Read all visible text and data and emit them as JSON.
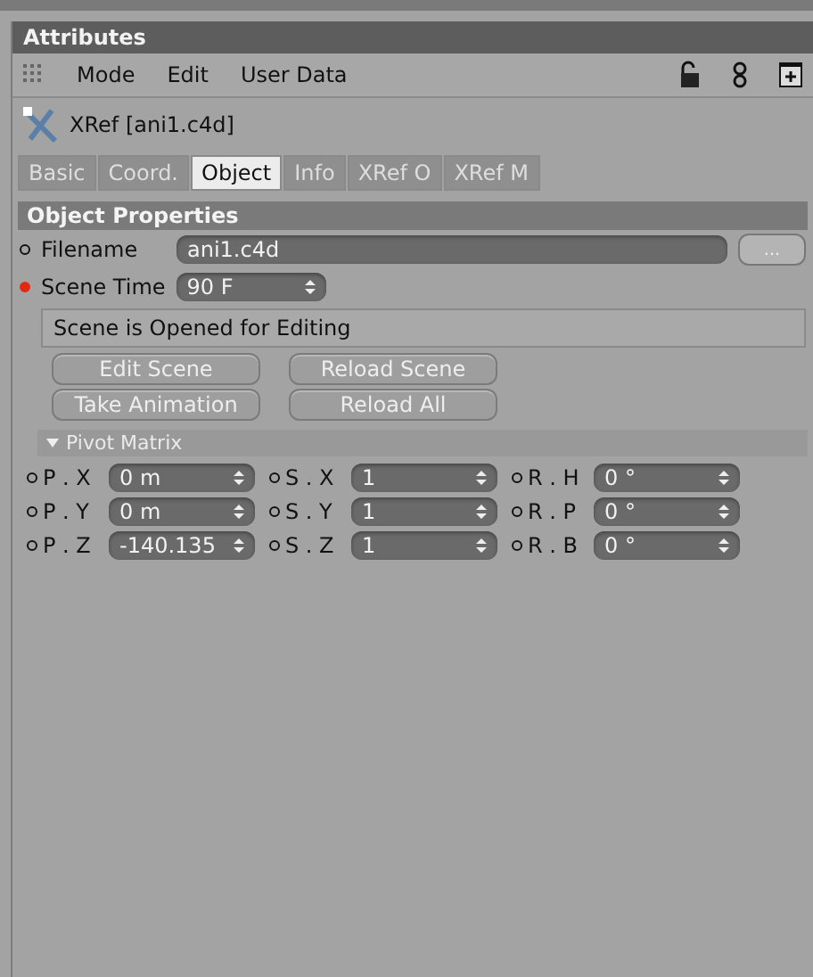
{
  "panel": {
    "title": "Attributes"
  },
  "menu": [
    "Mode",
    "Edit",
    "User Data"
  ],
  "object": {
    "name": "XRef [ani1.c4d]"
  },
  "tabs": [
    {
      "label": "Basic",
      "selected": false
    },
    {
      "label": "Coord.",
      "selected": false
    },
    {
      "label": "Object",
      "selected": true
    },
    {
      "label": "Info",
      "selected": false
    },
    {
      "label": "XRef O",
      "selected": false
    },
    {
      "label": "XRef M",
      "selected": false
    }
  ],
  "section": {
    "title": "Object Properties"
  },
  "filename": {
    "label": "Filename",
    "value": "ani1.c4d",
    "button": "..."
  },
  "scene_time": {
    "label": "Scene Time",
    "value": "90 F",
    "animated": true
  },
  "status": "Scene is Opened for Editing",
  "buttons": [
    [
      "Edit Scene",
      "Reload Scene"
    ],
    [
      "Take Animation",
      "Reload All"
    ]
  ],
  "pivot": {
    "title": "Pivot Matrix",
    "expanded": true,
    "rows": [
      [
        {
          "label": "P . X",
          "value": "0 m"
        },
        {
          "label": "S . X",
          "value": "1"
        },
        {
          "label": "R . H",
          "value": "0 °"
        }
      ],
      [
        {
          "label": "P . Y",
          "value": "0 m"
        },
        {
          "label": "S . Y",
          "value": "1"
        },
        {
          "label": "R . P",
          "value": "0 °"
        }
      ],
      [
        {
          "label": "P . Z",
          "value": "-140.135"
        },
        {
          "label": "S . Z",
          "value": "1"
        },
        {
          "label": "R . B",
          "value": "0 °"
        }
      ]
    ]
  }
}
